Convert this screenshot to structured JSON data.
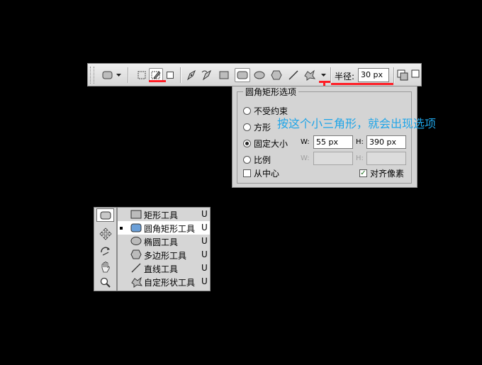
{
  "options_bar": {
    "radius_label": "半径:",
    "radius_value": "30 px",
    "icons": [
      "rounded-rect-tool-icon",
      "dropdown-arrow-icon",
      "shape-layers-icon",
      "paths-icon",
      "fill-pixels-icon",
      "pen-icon",
      "freeform-pen-icon",
      "rectangle-icon",
      "rounded-rectangle-icon",
      "ellipse-icon",
      "polygon-icon",
      "line-icon",
      "custom-shape-icon",
      "geometry-options-arrow-icon",
      "combine-icon"
    ]
  },
  "panel": {
    "title": "圆角矩形选项",
    "options": [
      {
        "label": "不受约束",
        "selected": false
      },
      {
        "label": "方形",
        "selected": false
      },
      {
        "label": "固定大小",
        "selected": true
      },
      {
        "label": "比例",
        "selected": false
      }
    ],
    "fixed": {
      "w_label": "W:",
      "w_value": "55 px",
      "h_label": "H:",
      "h_value": "390 px"
    },
    "ratio": {
      "w_label": "W:",
      "h_label": "H:"
    },
    "from_center": {
      "label": "从中心",
      "checked": false
    },
    "snap": {
      "label": "对齐像素",
      "checked": true
    }
  },
  "annotation": "按这个小三角形，就会出现选项",
  "flyout": {
    "items": [
      {
        "icon": "rectangle-icon",
        "label": "矩形工具",
        "key": "U"
      },
      {
        "icon": "rounded-rectangle-icon",
        "label": "圆角矩形工具",
        "key": "U",
        "current": true
      },
      {
        "icon": "ellipse-icon",
        "label": "椭圆工具",
        "key": "U"
      },
      {
        "icon": "polygon-icon",
        "label": "多边形工具",
        "key": "U"
      },
      {
        "icon": "line-icon",
        "label": "直线工具",
        "key": "U"
      },
      {
        "icon": "custom-shape-icon",
        "label": "自定形状工具",
        "key": "U"
      }
    ]
  },
  "colors": {
    "highlight": "#ff1d25",
    "annotation": "#1fa5e8",
    "selected_shape_fill": "#6a9fd8"
  }
}
